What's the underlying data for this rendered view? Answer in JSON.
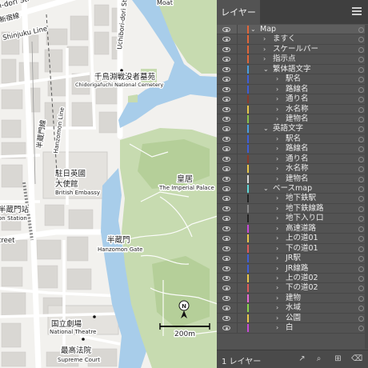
{
  "map": {
    "labels": {
      "moat": "Moat",
      "uchibori": "Uchibori-dori Street",
      "shinjuku_line": "Shinjuku Line",
      "shinjuku_kana": "新宿線",
      "hanzomon_line": "Hanzomon Line",
      "hanzomon_kana": "半蔵門線",
      "top_street": "i-dori Str",
      "chidori_jp": "千鳥淵戦没者墓苑",
      "chidori_en": "Chidorigafuchi National Cemetery",
      "british_jp_1": "駐日英國",
      "british_jp_2": "大使館",
      "british_en": "British Embassy",
      "palace_jp": "皇居",
      "palace_en": "The Imperial Palace",
      "station_jp": "半蔵門站",
      "station_en": "on Station",
      "street": "treet",
      "gate_jp": "半蔵門",
      "gate_en": "Hanzomon Gate",
      "theatre_jp": "国立劇場",
      "theatre_en": "National Theatre",
      "court_jp": "最高法院",
      "court_en": "Supreme Court"
    },
    "north": "N",
    "scale": "200m",
    "colors": {
      "land": "#f2f1ee",
      "water": "#a8cdea",
      "park": "#c7dbb0",
      "park_dark": "#b2cd97",
      "block": "#d8d6d2",
      "road": "#ffffff"
    }
  },
  "panel": {
    "tab": "レイヤー",
    "footer": "1 レイヤー",
    "footer_icons": [
      "export-icon",
      "search-icon",
      "new-layer-icon",
      "delete-icon"
    ],
    "layers": [
      {
        "label": "Map",
        "color": "#e0663a",
        "level": 0,
        "expanded": true
      },
      {
        "label": "ますく",
        "color": "#e0663a",
        "level": 1
      },
      {
        "label": "スケールバー",
        "color": "#e0663a",
        "level": 1
      },
      {
        "label": "指示点",
        "color": "#e0663a",
        "level": 1
      },
      {
        "label": "繁体語文字",
        "color": "#4aa0e0",
        "level": 1,
        "expanded": true
      },
      {
        "label": "駅名",
        "color": "#3f5fd8",
        "level": 2
      },
      {
        "label": "路線名",
        "color": "#3f5fd8",
        "level": 2
      },
      {
        "label": "通り名",
        "color": "#8a3a2a",
        "level": 2
      },
      {
        "label": "水名称",
        "color": "#e9c84a",
        "level": 2
      },
      {
        "label": "建物名",
        "color": "#8ac24a",
        "level": 2
      },
      {
        "label": "英語文字",
        "color": "#4aa0e0",
        "level": 1,
        "expanded": true
      },
      {
        "label": "駅名",
        "color": "#3f5fd8",
        "level": 2
      },
      {
        "label": "路線名",
        "color": "#3f5fd8",
        "level": 2
      },
      {
        "label": "通り名",
        "color": "#8a3a2a",
        "level": 2
      },
      {
        "label": "水名称",
        "color": "#e9c84a",
        "level": 2
      },
      {
        "label": "建物名",
        "color": "#d8d8d8",
        "level": 2
      },
      {
        "label": "ベースmap",
        "color": "#5fd8d8",
        "level": 1,
        "expanded": true
      },
      {
        "label": "地下鉄駅",
        "color": "#222222",
        "level": 2
      },
      {
        "label": "地下鉄線路",
        "color": "#8a8a8a",
        "level": 2
      },
      {
        "label": "地下入り口",
        "color": "#222222",
        "level": 2
      },
      {
        "label": "高速道路",
        "color": "#c84ad8",
        "level": 2
      },
      {
        "label": "上の道01",
        "color": "#e9c84a",
        "level": 2
      },
      {
        "label": "下の道01",
        "color": "#e05a5a",
        "level": 2
      },
      {
        "label": "JR駅",
        "color": "#3f5fd8",
        "level": 2
      },
      {
        "label": "JR線路",
        "color": "#3f5fd8",
        "level": 2
      },
      {
        "label": "上の道02",
        "color": "#e9c84a",
        "level": 2
      },
      {
        "label": "下の道02",
        "color": "#e05a5a",
        "level": 2
      },
      {
        "label": "建物",
        "color": "#e86ad8",
        "level": 2
      },
      {
        "label": "水域",
        "color": "#8ad84a",
        "level": 2
      },
      {
        "label": "公園",
        "color": "#e9c84a",
        "level": 2
      },
      {
        "label": "白",
        "color": "#c84ad8",
        "level": 2
      }
    ]
  }
}
